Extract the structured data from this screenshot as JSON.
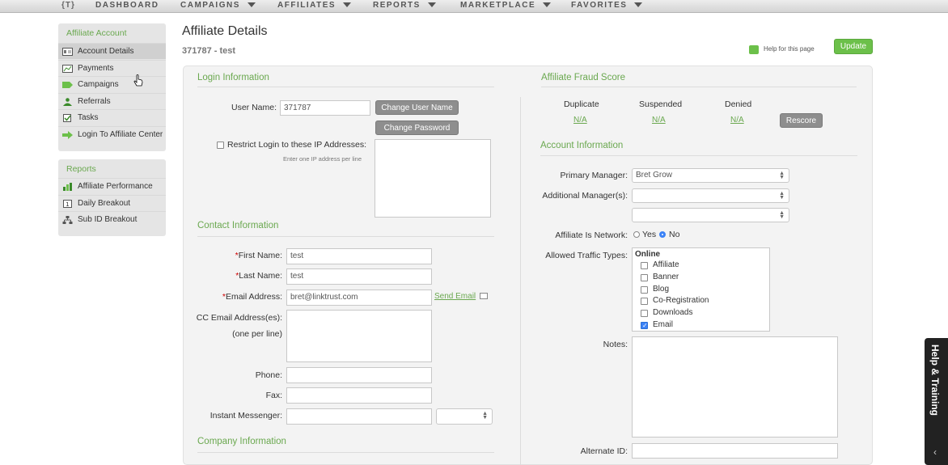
{
  "nav": {
    "logo": "{T}",
    "items": [
      {
        "label": "DASHBOARD",
        "caret": false
      },
      {
        "label": "CAMPAIGNS",
        "caret": true
      },
      {
        "label": "AFFILIATES",
        "caret": true
      },
      {
        "label": "REPORTS",
        "caret": true
      },
      {
        "label": "MARKETPLACE",
        "caret": true
      },
      {
        "label": "FAVORITES",
        "caret": true
      }
    ]
  },
  "sidebar": {
    "affiliate_title": "Affiliate Account",
    "affiliate_items": [
      {
        "label": "Account Details",
        "icon": "id-card-icon",
        "active": true
      },
      {
        "label": "Payments",
        "icon": "money-icon"
      },
      {
        "label": "Campaigns",
        "icon": "tag-icon"
      },
      {
        "label": "Referrals",
        "icon": "person-icon"
      },
      {
        "label": "Tasks",
        "icon": "checkbox-icon"
      },
      {
        "label": "Login To Affiliate Center",
        "icon": "arrow-right-icon"
      }
    ],
    "reports_title": "Reports",
    "reports_items": [
      {
        "label": "Affiliate Performance",
        "icon": "chart-icon"
      },
      {
        "label": "Daily Breakout",
        "icon": "calendar-icon"
      },
      {
        "label": "Sub ID Breakout",
        "icon": "hierarchy-icon"
      }
    ]
  },
  "header": {
    "title": "Affiliate Details",
    "subtitle": "371787 - test",
    "help_label": "Help for this page",
    "update_label": "Update"
  },
  "login": {
    "section": "Login Information",
    "username_label": "User Name:",
    "username_value": "371787",
    "change_username": "Change User Name",
    "change_password": "Change Password",
    "restrict_label": "Restrict Login to these IP Addresses:",
    "restrict_hint": "Enter one IP address per line"
  },
  "contact": {
    "section": "Contact Information",
    "first_label": "First Name:",
    "first_value": "test",
    "last_label": "Last Name:",
    "last_value": "test",
    "email_label": "Email Address:",
    "email_value": "bret@linktrust.com",
    "send_email": "Send Email",
    "cc_label": "CC Email Address(es):",
    "cc_hint": "(one per line)",
    "phone_label": "Phone:",
    "fax_label": "Fax:",
    "im_label": "Instant Messenger:"
  },
  "company": {
    "section": "Company Information"
  },
  "fraud": {
    "section": "Affiliate Fraud Score",
    "cols": [
      {
        "label": "Duplicate",
        "value": "N/A"
      },
      {
        "label": "Suspended",
        "value": "N/A"
      },
      {
        "label": "Denied",
        "value": "N/A"
      }
    ],
    "rescore": "Rescore"
  },
  "account": {
    "section": "Account Information",
    "primary_label": "Primary Manager:",
    "primary_value": "Bret Grow",
    "additional_label": "Additional Manager(s):",
    "network_label": "Affiliate Is Network:",
    "yes": "Yes",
    "no": "No",
    "traffic_label": "Allowed Traffic Types:",
    "traffic_group": "Online",
    "traffic_types": [
      {
        "label": "Affiliate",
        "checked": false
      },
      {
        "label": "Banner",
        "checked": false
      },
      {
        "label": "Blog",
        "checked": false
      },
      {
        "label": "Co-Registration",
        "checked": false
      },
      {
        "label": "Downloads",
        "checked": false
      },
      {
        "label": "Email",
        "checked": true
      }
    ],
    "notes_label": "Notes:",
    "alternate_label": "Alternate ID:"
  },
  "help_tab": {
    "label": "Help & Training"
  }
}
